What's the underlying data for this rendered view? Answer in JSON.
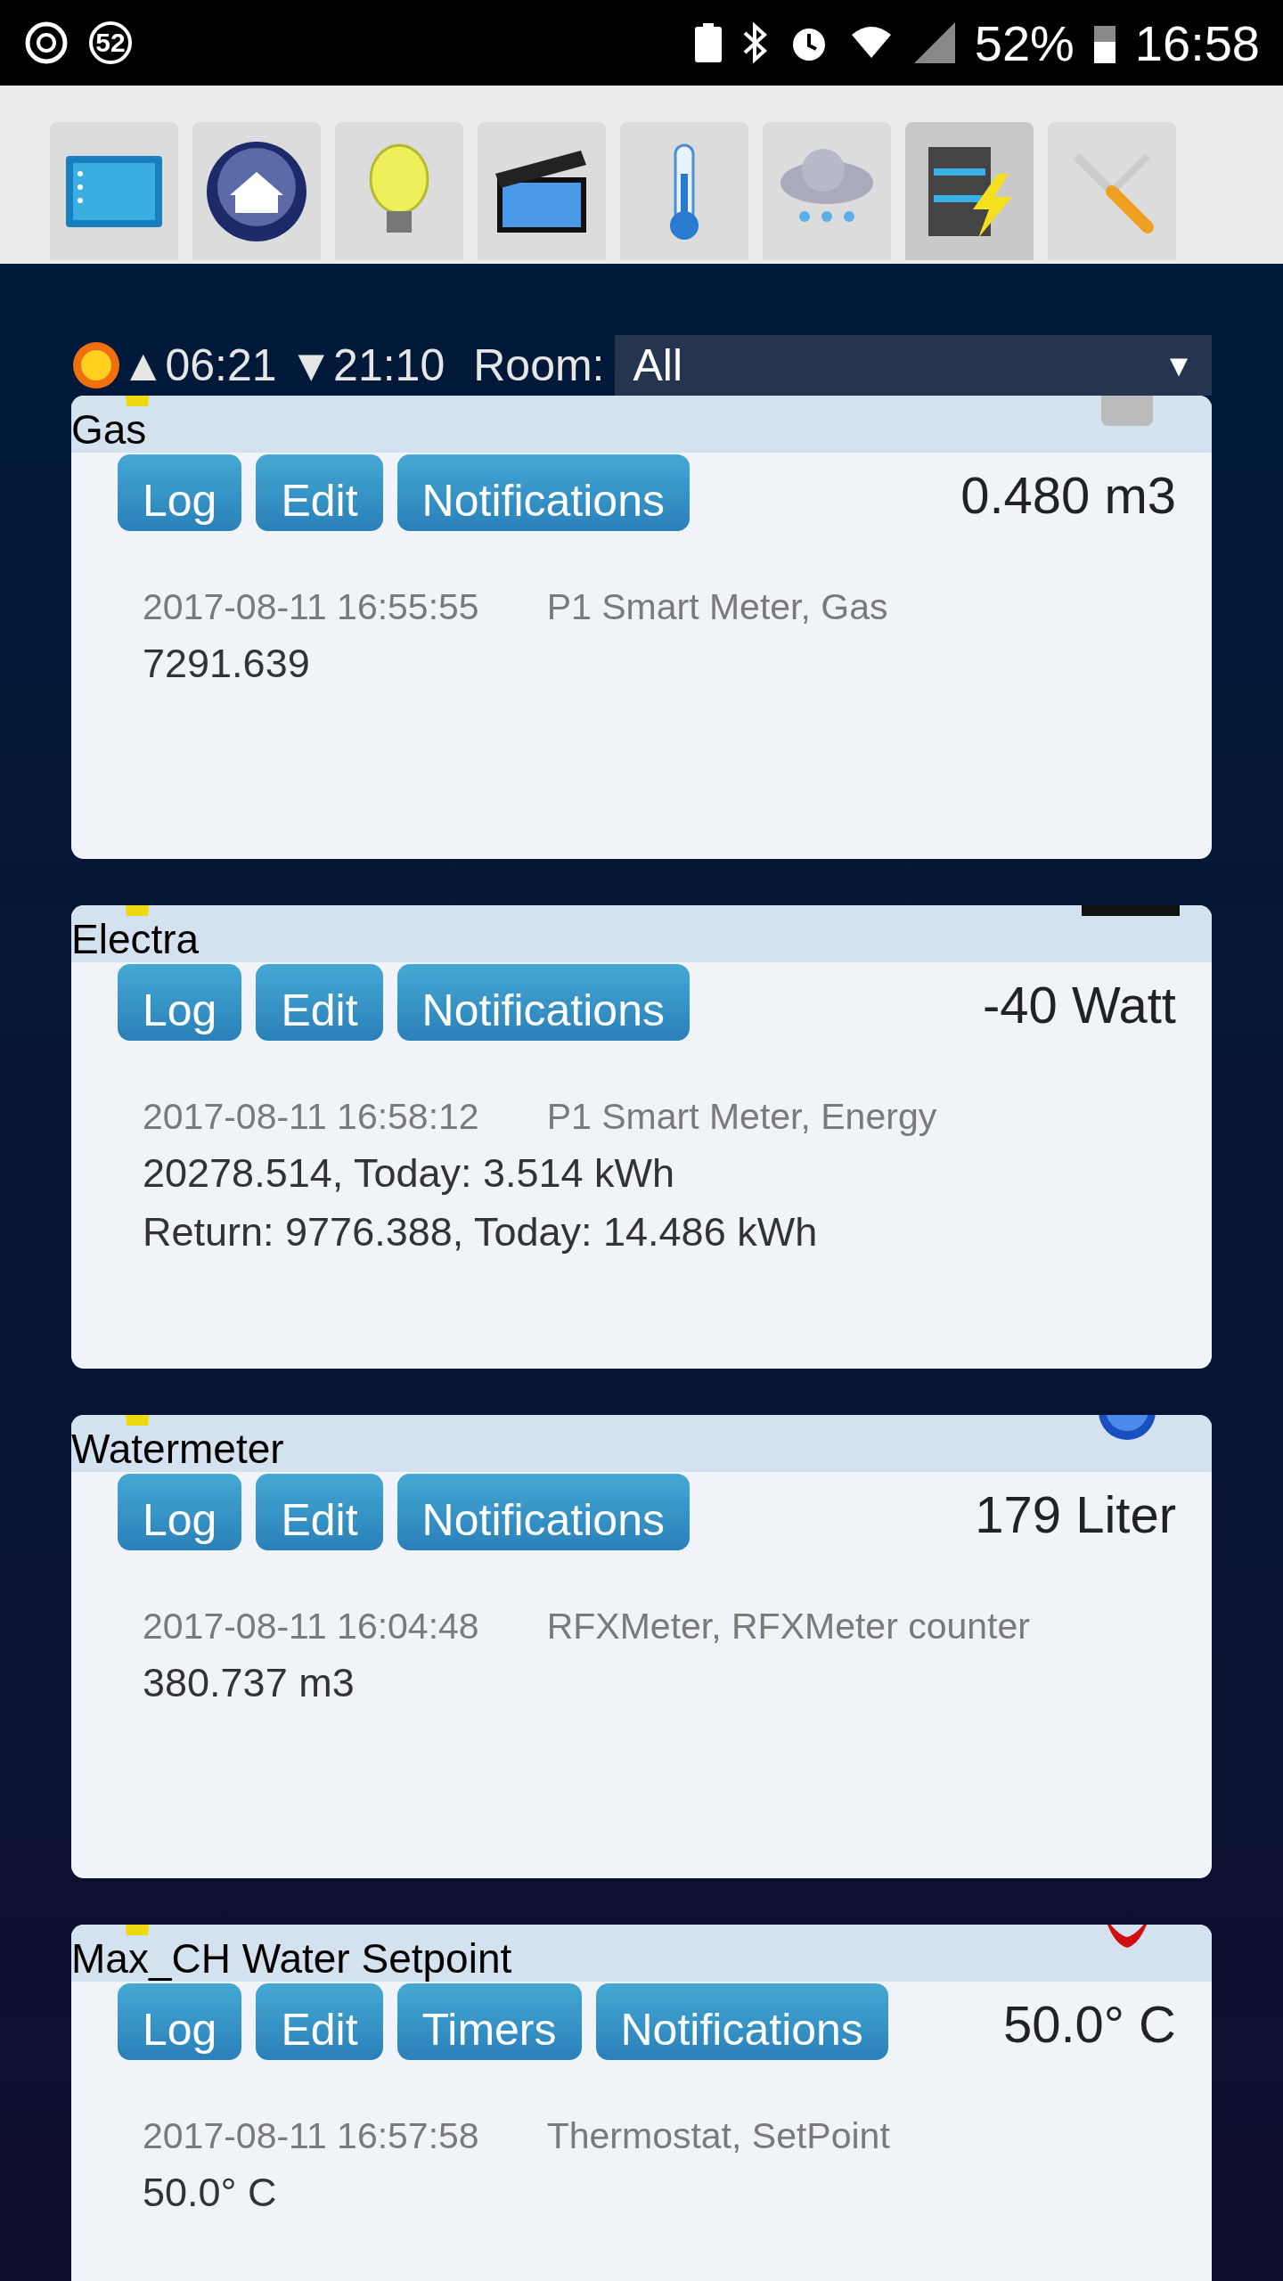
{
  "status_bar": {
    "notification_count": "52",
    "battery": "52%",
    "time": "16:58"
  },
  "nav": [
    {
      "kind": "dashboard",
      "selected": false
    },
    {
      "kind": "home",
      "selected": false
    },
    {
      "kind": "light",
      "selected": false
    },
    {
      "kind": "scene",
      "selected": false
    },
    {
      "kind": "temperature",
      "selected": false
    },
    {
      "kind": "weather",
      "selected": false
    },
    {
      "kind": "utility",
      "selected": true
    },
    {
      "kind": "setup",
      "selected": false
    }
  ],
  "sun": {
    "sunrise": "▲06:21",
    "sunset": "▼21:10"
  },
  "room": {
    "label": "Room:",
    "value": "All",
    "caret": "▼"
  },
  "devices": [
    {
      "name": "Gas",
      "kind": "gas",
      "buttons": [
        "Log",
        "Edit",
        "Notifications"
      ],
      "value": "0.480 m3",
      "timestamp": "2017-08-11 16:55:55",
      "type": "P1 Smart Meter, Gas",
      "data": [
        "7291.639"
      ]
    },
    {
      "name": "Electra",
      "kind": "energy",
      "buttons": [
        "Log",
        "Edit",
        "Notifications"
      ],
      "value": "-40 Watt",
      "timestamp": "2017-08-11 16:58:12",
      "type": "P1 Smart Meter, Energy",
      "data": [
        "20278.514, Today: 3.514 kWh",
        "Return: 9776.388, Today: 14.486 kWh"
      ]
    },
    {
      "name": "Watermeter",
      "kind": "water",
      "buttons": [
        "Log",
        "Edit",
        "Notifications"
      ],
      "value": "179 Liter",
      "timestamp": "2017-08-11 16:04:48",
      "type": "RFXMeter, RFXMeter counter",
      "data": [
        "380.737 m3"
      ]
    },
    {
      "name": "Max_CH Water Setpoint",
      "kind": "heating",
      "buttons": [
        "Log",
        "Edit",
        "Timers",
        "Notifications"
      ],
      "value": "50.0° C",
      "timestamp": "2017-08-11 16:57:58",
      "type": "Thermostat, SetPoint",
      "data": [
        "50.0° C"
      ]
    }
  ]
}
